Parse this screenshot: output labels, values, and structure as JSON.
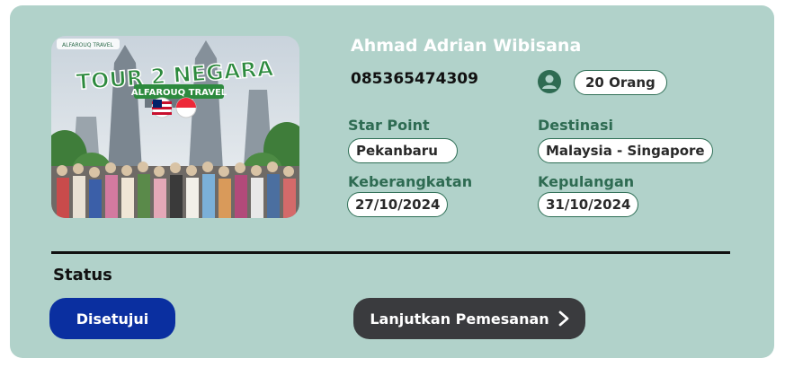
{
  "booking": {
    "customer_name": "Ahmad Adrian Wibisana",
    "phone": "085365474309",
    "participants": "20 Orang",
    "photo": {
      "brand_small": "ALFAROUQ TRAVEL",
      "title": "TOUR 2 NEGARA",
      "subtitle": "ALFAROUQ TRAVEL"
    },
    "start_point_label": "Star Point",
    "start_point": "Pekanbaru",
    "destination_label": "Destinasi",
    "destination": "Malaysia - Singapore",
    "departure_label": "Keberangkatan",
    "departure": "27/10/2024",
    "return_label": "Kepulangan",
    "return": "31/10/2024"
  },
  "status": {
    "label": "Status",
    "badge": "Disetujui",
    "badge_color": "#0a2fa0"
  },
  "actions": {
    "continue_label": "Lanjutkan Pemesanan",
    "continue_icon": "chevron-right-icon"
  },
  "colors": {
    "card_bg": "#b1d2ca",
    "accent_green": "#2e6b52",
    "dark_button": "#3a3b3e"
  }
}
